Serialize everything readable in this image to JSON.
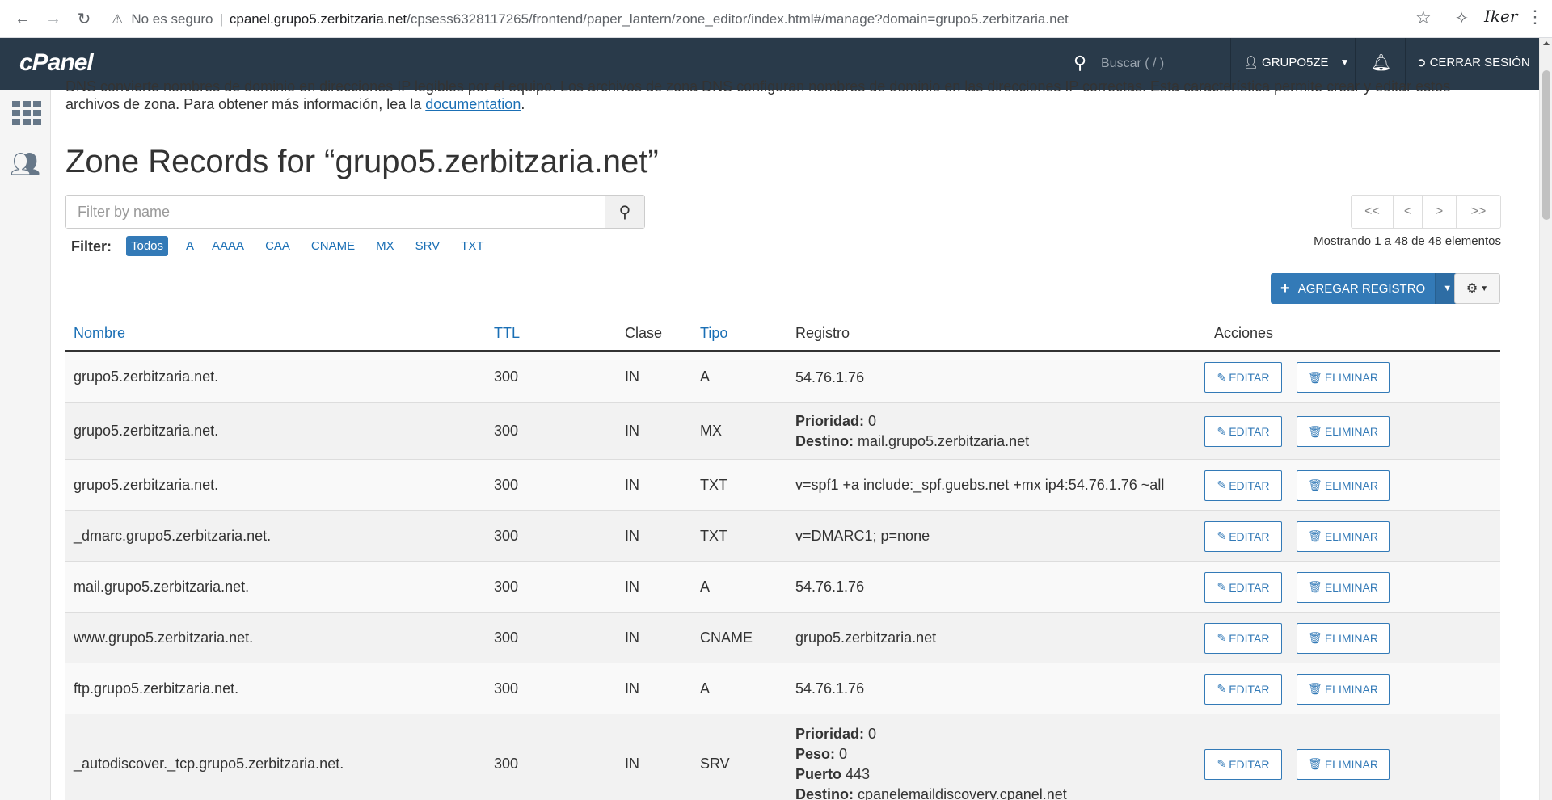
{
  "browser": {
    "insecure_label": "No es seguro",
    "url_host": "cpanel.grupo5.zerbitzaria.net",
    "url_path": "/cpsess6328117265/frontend/paper_lantern/zone_editor/index.html#/manage?domain=grupo5.zerbitzaria.net",
    "profile_text": "Iker"
  },
  "cpanel": {
    "logo": "cPanel",
    "search_placeholder": "Buscar ( / )",
    "user": "GRUPO5ZE",
    "logout": "CERRAR SESIÓN"
  },
  "intro": {
    "line1": "DNS convierte nombres de dominio en direcciones IP legibles por el equipo. Los archivos de zona DNS configuran nombres de dominio en las direcciones IP correctas. Esta característica permite crear y editar estos",
    "line2": "archivos de zona. Para obtener más información, lea la ",
    "link": "documentation",
    "end": "."
  },
  "page_title": "Zone Records for “grupo5.zerbitzaria.net”",
  "filter": {
    "placeholder": "Filter by name",
    "label": "Filter:",
    "types": [
      "Todos",
      "A",
      "AAAA",
      "CAA",
      "CNAME",
      "MX",
      "SRV",
      "TXT"
    ],
    "active": "Todos"
  },
  "pager": {
    "first": "<<",
    "prev": "<",
    "next": ">",
    "last": ">>"
  },
  "showing": "Mostrando 1 a 48 de 48 elementos",
  "add_button": "AGREGAR REGISTRO",
  "table": {
    "headers": {
      "name": "Nombre",
      "ttl": "TTL",
      "class": "Clase",
      "type": "Tipo",
      "record": "Registro",
      "actions": "Acciones"
    },
    "edit_label": "EDITAR",
    "delete_label": "ELIMINAR",
    "rows": [
      {
        "name": "grupo5.zerbitzaria.net.",
        "ttl": "300",
        "class": "IN",
        "type": "A",
        "record": [
          {
            "k": "",
            "v": "54.76.1.76"
          }
        ]
      },
      {
        "name": "grupo5.zerbitzaria.net.",
        "ttl": "300",
        "class": "IN",
        "type": "MX",
        "record": [
          {
            "k": "Prioridad:",
            "v": " 0"
          },
          {
            "k": "Destino:",
            "v": " mail.grupo5.zerbitzaria.net"
          }
        ]
      },
      {
        "name": "grupo5.zerbitzaria.net.",
        "ttl": "300",
        "class": "IN",
        "type": "TXT",
        "record": [
          {
            "k": "",
            "v": "v=spf1 +a include:_spf.guebs.net +mx ip4:54.76.1.76 ~all"
          }
        ]
      },
      {
        "name": "_dmarc.grupo5.zerbitzaria.net.",
        "ttl": "300",
        "class": "IN",
        "type": "TXT",
        "record": [
          {
            "k": "",
            "v": "v=DMARC1; p=none"
          }
        ]
      },
      {
        "name": "mail.grupo5.zerbitzaria.net.",
        "ttl": "300",
        "class": "IN",
        "type": "A",
        "record": [
          {
            "k": "",
            "v": "54.76.1.76"
          }
        ]
      },
      {
        "name": "www.grupo5.zerbitzaria.net.",
        "ttl": "300",
        "class": "IN",
        "type": "CNAME",
        "record": [
          {
            "k": "",
            "v": "grupo5.zerbitzaria.net"
          }
        ]
      },
      {
        "name": "ftp.grupo5.zerbitzaria.net.",
        "ttl": "300",
        "class": "IN",
        "type": "A",
        "record": [
          {
            "k": "",
            "v": "54.76.1.76"
          }
        ]
      },
      {
        "name": "_autodiscover._tcp.grupo5.zerbitzaria.net.",
        "ttl": "300",
        "class": "IN",
        "type": "SRV",
        "record": [
          {
            "k": "Prioridad:",
            "v": " 0"
          },
          {
            "k": "Peso:",
            "v": " 0"
          },
          {
            "k": "Puerto",
            "v": " 443"
          },
          {
            "k": "Destino:",
            "v": " cpanelemaildiscovery.cpanel.net"
          }
        ]
      }
    ]
  },
  "colors": {
    "topbar": "#293a4a",
    "accent": "#337ab7",
    "link": "#1a6fb5"
  }
}
